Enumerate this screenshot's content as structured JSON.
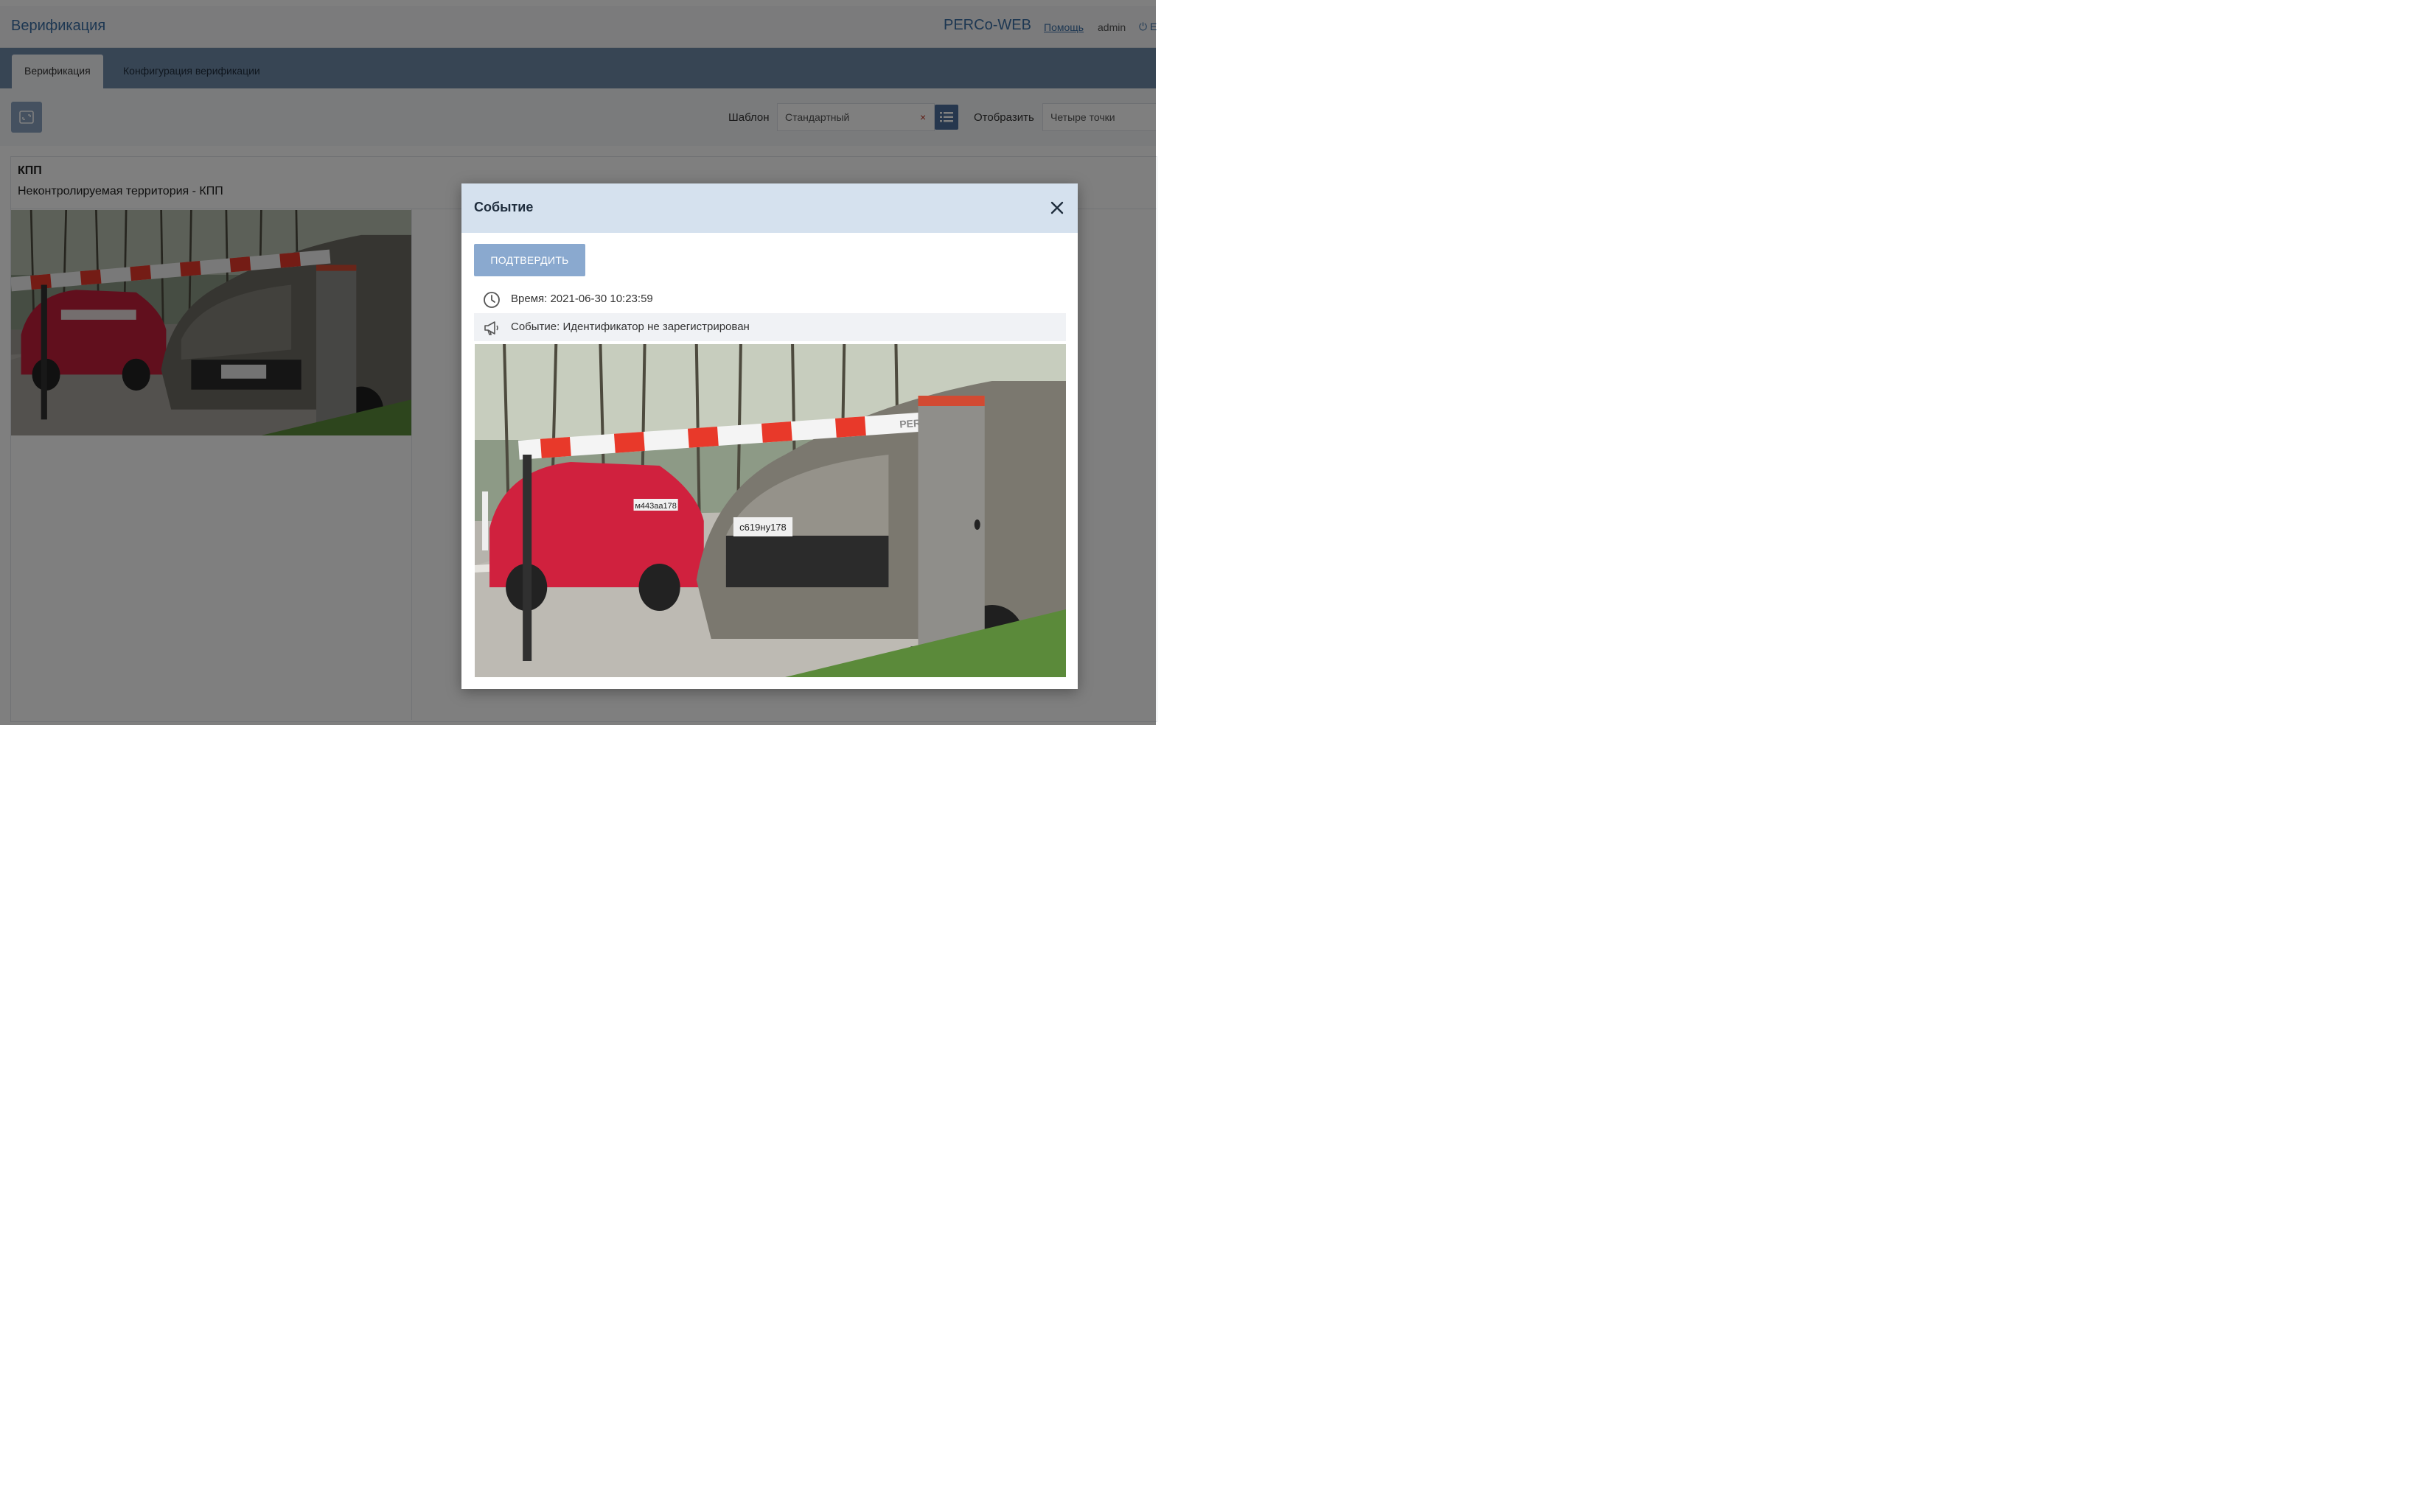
{
  "header": {
    "title": "Верификация",
    "brand": "PERCo-WEB",
    "help": "Помощь",
    "user": "admin",
    "logout_fragment": "⏻ E"
  },
  "tabs": [
    {
      "label": "Верификация",
      "active": true
    },
    {
      "label": "Конфигурация верификации",
      "active": false
    }
  ],
  "toolbar": {
    "template_label": "Шаблон",
    "template_value": "Стандартный",
    "template_clear": "×",
    "display_label": "Отобразить",
    "display_value": "Четыре точки"
  },
  "panel": {
    "title": "КПП",
    "subtitle": "Неконтролируемая территория - КПП"
  },
  "modal": {
    "title": "Событие",
    "confirm_label": "ПОДТВЕРДИТЬ",
    "time_label": "Время:",
    "time_value": "2021-06-30 10:23:59",
    "event_label": "Событие:",
    "event_value": "Идентификатор не зарегистрирован"
  },
  "photo": {
    "barrier_brand": "PERCo",
    "plate_left": "м443аа178",
    "plate_right": "с619ну178"
  },
  "colors": {
    "accent": "#3a6ea5",
    "tabs_bar": "#6f8aa8",
    "confirm_button": "#8aa9cf",
    "modal_header": "#d5e1ee",
    "barrier_red": "#e8392a"
  }
}
